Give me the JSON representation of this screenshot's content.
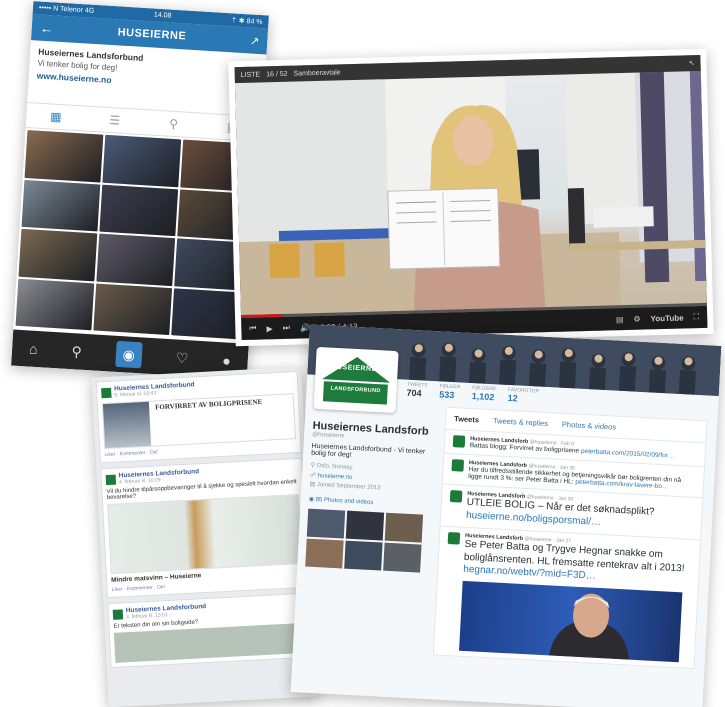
{
  "instagram": {
    "status": {
      "carrier": "••••• N Telenor  4G",
      "time": "14.08",
      "battery": "⇡ ✱ 84 %"
    },
    "header_title": "HUSEIERNE",
    "profile": {
      "name": "Huseiernes Landsforbund",
      "bio": "Vi tenker bolig for deg!",
      "url": "www.huseierne.no"
    },
    "icons": [
      "back-arrow-icon",
      "share-icon",
      "grid-view-icon",
      "list-view-icon",
      "location-icon",
      "tagged-icon",
      "home-icon",
      "search-icon",
      "camera-icon",
      "activity-icon",
      "profile-icon"
    ],
    "tile_colors": [
      "#8a6b4f",
      "#4a5b7a",
      "#6b4d3a",
      "#7b8a96",
      "#3c3e4d",
      "#5a4a3b",
      "#7a6a52",
      "#5f5a67",
      "#3f4a5e",
      "#8b8d92",
      "#6a5b4a",
      "#2d3448"
    ]
  },
  "video": {
    "topbar_label": "LISTE",
    "counter": "16 / 52",
    "title": "Samboeravtale",
    "time": "0:22 / 4:13",
    "progress": 0.087,
    "brand": "YouTube",
    "progress_color": "#cc181e"
  },
  "facebook": {
    "posts": [
      {
        "author": "Huseiernes Landsforbund",
        "meta": "5. februar kl. 15:43 · ",
        "link_title": "FORVIRRET AV BOLIGPRISENE",
        "actions": "Liker · Kommenter · Del"
      },
      {
        "author": "Huseiernes Landsforbund",
        "meta": "4. februar kl. 10:29 · ",
        "text": "Vil du hindre tilpårsoppbevaringer til å sjekke og spesielt hvordan enkelt bevarelse?",
        "link_title": "Mindre matsvinn – Huseierne",
        "actions": "Liker · Kommenter · Del"
      },
      {
        "author": "Huseiernes Landsforbund",
        "meta": "3. februar kl. 13:51 · ",
        "text": "Er teksten din om sin boligside?"
      }
    ]
  },
  "twitter": {
    "logo_text": [
      "HUSEIERNES",
      "LANDSFORBUND"
    ],
    "stats": [
      {
        "label": "TWEETS",
        "value": "704",
        "active": true
      },
      {
        "label": "FØLGER",
        "value": "533",
        "active": false
      },
      {
        "label": "FØLGERE",
        "value": "1,102",
        "active": false
      },
      {
        "label": "FAVORITTER",
        "value": "12",
        "active": false
      }
    ],
    "name": "Huseiernes Landsforb",
    "handle": "@huseierne",
    "bio": "Huseiernes Landsforbund - Vi tenker bolig for deg!",
    "location": "Oslo, Norway",
    "website": "huseierne.no",
    "joined": "Joined September 2013",
    "photos_label": "85 Photos and videos",
    "tabs": {
      "tweets": "Tweets",
      "replies": "Tweets & replies",
      "photos": "Photos & videos"
    },
    "tweets": [
      {
        "author": "Huseiernes Landsforb",
        "meta": "@huseierne · Feb 9",
        "text": "Battas blogg: Forvirret av boligprisene ",
        "link": "peterbatta.com/2015/02/09/for…"
      },
      {
        "author": "Huseiernes Landsforb",
        "meta": "@huseierne · Jan 30",
        "text": "Har du tilfredsstillende sikkerhet og betjeningsvilkår bør boligrenten din nå ligge rundt 3 %: ser Peter Batta i HL: ",
        "link": "peterbatta.com/krav-lavere-bo…"
      },
      {
        "author": "Huseiernes Landsforb",
        "meta": "@huseierne · Jan 30",
        "text": "UTLEIE BOLIG – Når er det søknadsplikt? ",
        "link": "huseierne.no/boligsporsmal/…"
      },
      {
        "author": "Huseiernes Landsforb",
        "meta": "@huseierne · Jan 27",
        "text": "Se Peter Batta og Trygve Hegnar snakke om boliglånsrenten. HL fremsatte rentekrav alt i 2013! ",
        "link": "hegnar.no/webtv/?mid=F3D…"
      }
    ]
  }
}
